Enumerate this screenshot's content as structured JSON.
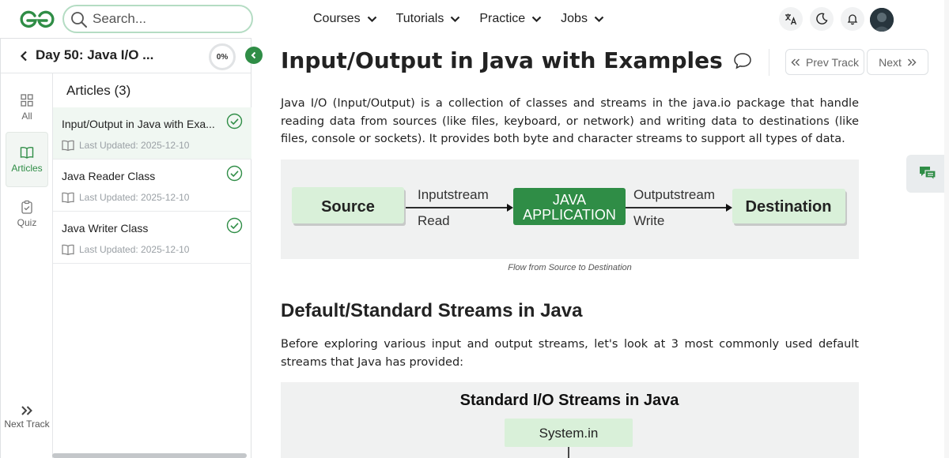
{
  "header": {
    "logo_alt": "GfG",
    "search_placeholder": "Search...",
    "nav": [
      "Courses",
      "Tutorials",
      "Practice",
      "Jobs"
    ]
  },
  "course": {
    "day_title": "Day 50: Java I/O ...",
    "progress": "0%",
    "rail": {
      "all": "All",
      "articles": "Articles",
      "quiz": "Quiz",
      "next_track": "Next Track"
    },
    "articles_heading": "Articles (3)",
    "articles": [
      {
        "title": "Input/Output in Java with Exa...",
        "updated": "Last Updated: 2025-12-10",
        "completed": true,
        "active": true
      },
      {
        "title": "Java Reader Class",
        "updated": "Last Updated: 2025-12-10",
        "completed": true,
        "active": false
      },
      {
        "title": "Java Writer Class",
        "updated": "Last Updated: 2025-12-10",
        "completed": true,
        "active": false
      }
    ]
  },
  "article": {
    "title": "Input/Output in Java with Examples",
    "prev_label": "Prev Track",
    "next_label": "Next",
    "intro": "Java I/O (Input/Output) is a collection of classes and streams in the java.io package that handle reading data from sources (like files, keyboard, or network) and writing data to destinations (like files, console or sockets). It provides both byte and character streams to support all types of data.",
    "diagram": {
      "source": "Source",
      "in_top": "Inputstream",
      "in_bottom": "Read",
      "app_line1": "JAVA",
      "app_line2": "APPLICATION",
      "out_top": "Outputstream",
      "out_bottom": "Write",
      "destination": "Destination"
    },
    "caption": "Flow from Source to Destination",
    "section_title": "Default/Standard Streams in Java",
    "section_para": "Before exploring various input and output streams, let's look at 3 most commonly used default streams that Java has provided:",
    "figure2": {
      "title": "Standard I/O Streams in Java",
      "box": "System.in"
    }
  },
  "colors": {
    "brand_green": "#2f8d46",
    "light_green": "#d9f0d9",
    "figure_bg": "#f0f1f1"
  }
}
